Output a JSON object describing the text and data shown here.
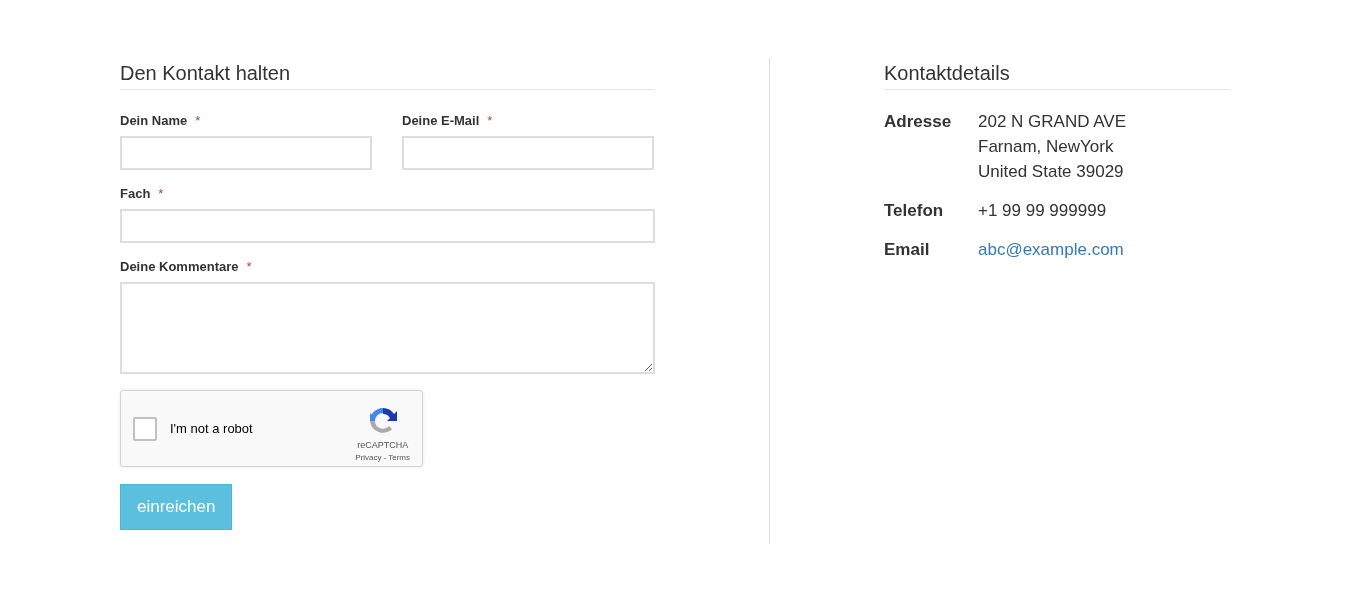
{
  "form": {
    "title": "Den Kontakt halten",
    "fields": [
      {
        "label": "Dein Name",
        "mark": "*",
        "kind": "short_input"
      },
      {
        "label": "Deine E-Mail",
        "mark": "*",
        "kind": "short_input"
      },
      {
        "label": "Fach",
        "mark": "*",
        "kind": "input"
      },
      {
        "label": "Deine Kommentare",
        "mark": "*",
        "kind": "textarea"
      }
    ],
    "captcha": {
      "checked": false,
      "label": "I'm not a robot",
      "brand": "reCAPTCHA",
      "links": [
        "Privacy",
        "Terms"
      ],
      "separator": "-"
    },
    "submit": "einreichen"
  },
  "details": {
    "title": "Kontaktdetails",
    "rows": [
      {
        "label": "Adresse",
        "kind": "text",
        "lines": [
          "202 N GRAND AVE",
          "Farnam, NewYork",
          "United State 39029"
        ]
      },
      {
        "label": "Telefon",
        "kind": "text",
        "lines": [
          "+1 99 99 999999"
        ]
      },
      {
        "label": "Email",
        "kind": "link",
        "lines": [
          "abc@example.com"
        ]
      }
    ]
  }
}
